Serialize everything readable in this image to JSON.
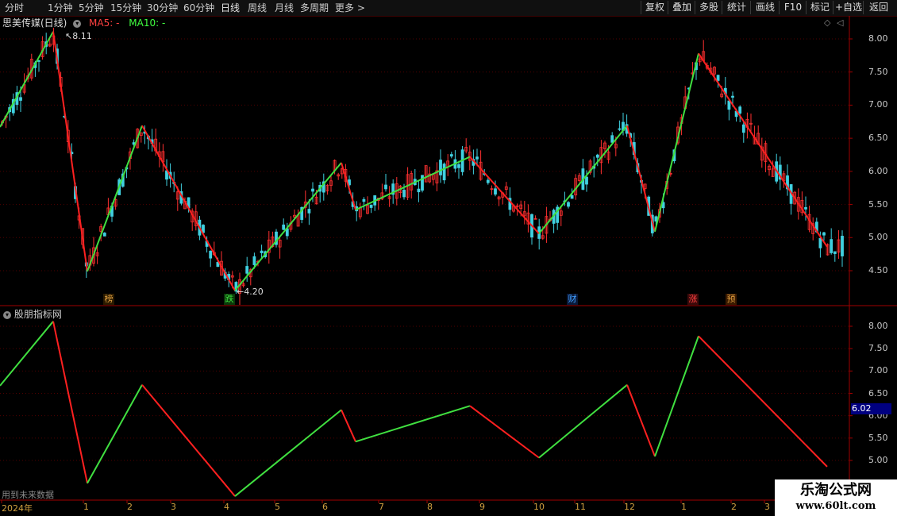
{
  "toolbar": {
    "periods": [
      "分时",
      "1分钟",
      "5分钟",
      "15分钟",
      "30分钟",
      "60分钟",
      "日线",
      "周线",
      "月线",
      "多周期",
      "更多"
    ],
    "active_period": "日线",
    "buttons": [
      "复权",
      "叠加",
      "多股",
      "统计",
      "画线",
      "F10",
      "标记",
      "+自选",
      "返回"
    ]
  },
  "main_panel": {
    "stock_title": "思美传媒(日线)",
    "ma5_label": "MA5: -",
    "ma10_label": "MA10: -",
    "y_ticks": [
      "8.00",
      "7.50",
      "7.00",
      "6.50",
      "6.00",
      "5.50",
      "5.00",
      "4.50"
    ],
    "high_label": "8.11",
    "low_label": "4.20",
    "markers": [
      {
        "text": "榜",
        "color": "#e0a040"
      },
      {
        "text": "跌",
        "color": "#40e040"
      },
      {
        "text": "财",
        "color": "#40a0ff"
      },
      {
        "text": "涨",
        "color": "#ff4040"
      },
      {
        "text": "预",
        "color": "#e0a040"
      }
    ]
  },
  "sub_panel": {
    "title": "股朋指标网",
    "y_ticks": [
      "8.00",
      "7.50",
      "7.00",
      "6.50",
      "6.00",
      "5.50",
      "5.00"
    ],
    "current_value": "6.02",
    "note": "用到未来数据"
  },
  "x_axis": {
    "labels": [
      "2024年",
      "1",
      "2",
      "3",
      "4",
      "5",
      "6",
      "7",
      "8",
      "9",
      "10",
      "11",
      "12",
      "1",
      "2",
      "3"
    ]
  },
  "watermark": {
    "title": "乐淘公式网",
    "url": "www.60lt.com"
  },
  "colors": {
    "up": "#ff3030",
    "down": "#40ff40",
    "zigzag_up": "#40e040",
    "zigzag_down": "#ff2020",
    "grid": "#500000",
    "axis": "#a00000"
  },
  "chart_data": {
    "type": "line",
    "title": "",
    "series": [
      {
        "values": [
          6.67,
          8.11,
          4.49,
          6.69,
          4.2,
          6.13,
          5.42,
          6.22,
          5.06,
          6.69,
          5.09,
          7.78,
          4.86
        ]
      }
    ],
    "ylim": [
      4.2,
      8.2
    ]
  }
}
